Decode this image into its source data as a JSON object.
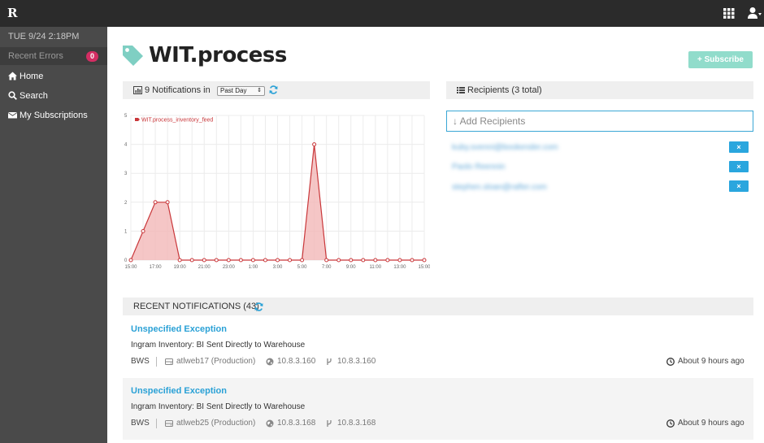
{
  "topbar": {
    "logo": "R",
    "logo_icon": "rafter-logo-icon",
    "apps_icon": "grid-icon",
    "user_icon": "user-icon"
  },
  "sidebar": {
    "datetime": "TUE 9/24 2:18PM",
    "recent_errors": {
      "label": "Recent Errors",
      "count": "0"
    },
    "items": [
      {
        "label": "Home",
        "icon": "home-icon"
      },
      {
        "label": "Search",
        "icon": "search-icon"
      },
      {
        "label": "My Subscriptions",
        "icon": "envelope-icon"
      }
    ]
  },
  "page": {
    "title": "WIT.process",
    "title_icon": "tag-icon",
    "subscribe_label": "+ Subscribe"
  },
  "notifications_panel": {
    "label": "9 Notifications in",
    "range": "Past Day",
    "icon": "bar-chart-icon"
  },
  "recipients_panel": {
    "label": "Recipients (3 total)",
    "add_placeholder": "↓ Add Recipients",
    "remove_label": "×",
    "recipients": [
      "kuby.svenni@bookender.com",
      "Paolo Reennin",
      "stephen.sloan@rafter.com"
    ]
  },
  "recent": {
    "label": "Recent Notifications (43)",
    "rows": [
      {
        "title": "Unspecified Exception",
        "message": "Ingram Inventory: BI Sent Directly to Warehouse",
        "app": "BWS",
        "host": "atlweb17 (Production)",
        "ip": "10.8.3.160",
        "fork": "10.8.3.160",
        "time": "About 9 hours ago"
      },
      {
        "title": "Unspecified Exception",
        "message": "Ingram Inventory: BI Sent Directly to Warehouse",
        "app": "BWS",
        "host": "atlweb25 (Production)",
        "ip": "10.8.3.168",
        "fork": "10.8.3.168",
        "time": "About 9 hours ago"
      }
    ]
  },
  "colors": {
    "accent": "#2aa1d6",
    "series": "#c9373a",
    "series_fill": "#f2b8b8",
    "subscribe": "#91dccb",
    "badge": "#d42d63"
  },
  "chart_data": {
    "type": "area",
    "series": [
      {
        "name": "WIT.process_inventory_feed",
        "values": [
          0,
          1,
          2,
          2,
          0,
          0,
          0,
          0,
          0,
          0,
          0,
          0,
          0,
          0,
          0,
          4,
          0,
          0,
          0,
          0,
          0,
          0,
          0,
          0,
          0
        ]
      }
    ],
    "x_tick_labels": [
      "15:00",
      "17:00",
      "19:00",
      "21:00",
      "23:00",
      "1:00",
      "3:00",
      "5:00",
      "7:00",
      "9:00",
      "11:00",
      "13:00",
      "15:00"
    ],
    "ylim": [
      0,
      5
    ],
    "y_ticks": [
      "0",
      "1",
      "2",
      "3",
      "4",
      "5"
    ],
    "grid": true,
    "legend": "top-left"
  }
}
